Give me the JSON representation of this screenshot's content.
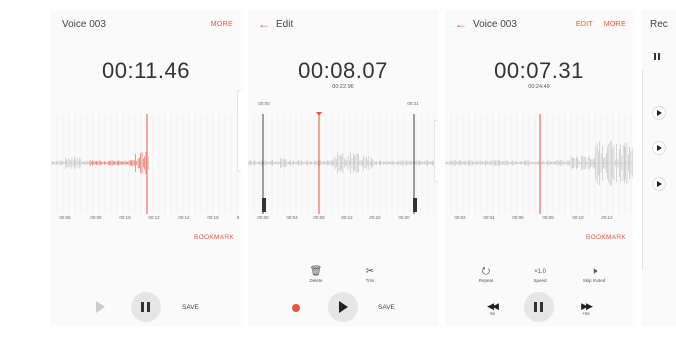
{
  "colors": {
    "accent": "#e8553f",
    "wave": "#b8b8b8",
    "panel_bg": "#fafafa"
  },
  "screen1": {
    "title": "Voice 003",
    "more": "MORE",
    "timer": "00:11.46",
    "ticks": [
      "00:06",
      "00:08",
      "00:10",
      "00:12",
      "00:14",
      "00:16",
      "0"
    ],
    "bookmark": "BOOKMARK",
    "save": "SAVE",
    "icons": {
      "play": "play-icon",
      "pause": "pause-icon"
    }
  },
  "screen2": {
    "title": "Edit",
    "timer": "00:08.07",
    "duration": "00:22.96",
    "range_start": "00:00",
    "range_end": "00:21",
    "ticks": [
      "00:00",
      "00:04",
      "00:08",
      "00:12",
      "00:16",
      "00:20"
    ],
    "tools": [
      {
        "label": "Delete",
        "icon": "trash-icon"
      },
      {
        "label": "Trim",
        "icon": "scissors-icon"
      }
    ],
    "save": "SAVE",
    "icons": {
      "record": "record-icon",
      "play": "play-icon"
    }
  },
  "screen3": {
    "title": "Voice 003",
    "edit": "EDIT",
    "more": "MORE",
    "timer": "00:07.31",
    "duration": "00:24.49",
    "ticks": [
      "00:02",
      "00:04",
      "00:06",
      "00:08",
      "00:10",
      "00:12"
    ],
    "bookmark": "BOOKMARK",
    "tools": [
      {
        "label": "Repeat",
        "icon": "repeat-icon"
      },
      {
        "label": "Speed",
        "value": "×1.0"
      },
      {
        "label": "Skip muted",
        "icon": "skip-muted-icon"
      }
    ],
    "rewind_label": "-5s",
    "forward_label": "+5s"
  },
  "screen4": {
    "title": "Rec"
  }
}
